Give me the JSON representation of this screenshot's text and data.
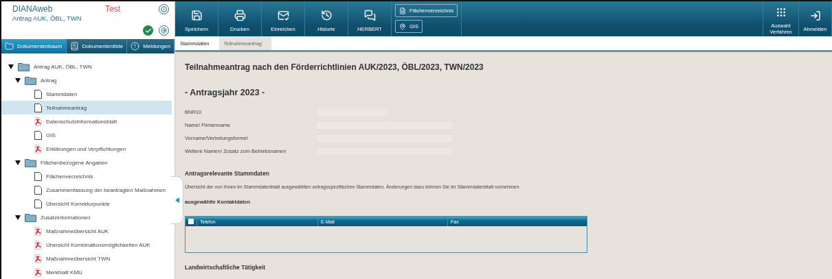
{
  "app": {
    "name": "DIANAweb",
    "environment": "Test",
    "subtitle": "Antrag AUK, ÖBL, TWN"
  },
  "side_tabs": [
    {
      "label": "Dokumentenbaum",
      "selected": true
    },
    {
      "label": "Dokumentenliste",
      "selected": false
    },
    {
      "label": "Meldungen",
      "selected": false
    }
  ],
  "tree": [
    {
      "label": "Antrag AUK, ÖBL, TWN",
      "kind": "folder",
      "expanded": true,
      "selected": false,
      "children": [
        {
          "label": "Antrag",
          "kind": "folder",
          "expanded": true,
          "selected": false,
          "children": [
            {
              "label": "Stammdaten",
              "kind": "doc",
              "selected": false
            },
            {
              "label": "Teilnahmeantrag",
              "kind": "doc",
              "selected": true
            },
            {
              "label": "Datenschutzinformationsblatt",
              "kind": "pdf",
              "selected": false
            },
            {
              "label": "GIS",
              "kind": "doc",
              "selected": false
            },
            {
              "label": "Erklärungen und Verpflichtungen",
              "kind": "pdf",
              "selected": false
            }
          ]
        },
        {
          "label": "Flächenbezogene Angaben",
          "kind": "folder",
          "expanded": true,
          "selected": false,
          "children": [
            {
              "label": "Flächenverzeichnis",
              "kind": "doc",
              "selected": false
            },
            {
              "label": "Zusammenfassung der beantragten Maßnahmen",
              "kind": "doc",
              "selected": false
            },
            {
              "label": "Übersicht Korrekturpunkte",
              "kind": "doc",
              "selected": false
            }
          ]
        },
        {
          "label": "Zusatzinformationen",
          "kind": "folder",
          "expanded": true,
          "selected": false,
          "children": [
            {
              "label": "Maßnahmeübersicht AUK",
              "kind": "pdf",
              "selected": false
            },
            {
              "label": "Übersicht Kombinationsmöglichkeiten AUK",
              "kind": "pdf",
              "selected": false
            },
            {
              "label": "Maßnahmeübersicht TWN",
              "kind": "pdf",
              "selected": false
            },
            {
              "label": "Merkblatt KMU",
              "kind": "pdf",
              "selected": false
            }
          ]
        }
      ]
    }
  ],
  "toolbar": [
    "Speichern",
    "Drucken",
    "Einreichen",
    "Historie",
    "HERBERT"
  ],
  "toolbar_links": [
    "Flächenverzeichnis",
    "GIS"
  ],
  "toolbar_right": [
    "Auswahl Verfahren",
    "Abmelden"
  ],
  "tabs": [
    {
      "label": "Stammdaten",
      "selected": true
    },
    {
      "label": "Teilnahmeantrag",
      "selected": false
    }
  ],
  "form": {
    "title": "Teilnahmeantrag nach den Förderrichtlinien AUK/2023, ÖBL/2023, TWN/2023",
    "year_heading": "- Antragsjahr 2023 -",
    "fields": [
      "BNR10",
      "Name/ Firmenname",
      "Vorname/Vertretungsformel",
      "Weitere Namen/ Zusatz zum Betriebsnamen"
    ],
    "section": "Antragsrelevante Stammdaten",
    "description": "Übersicht der von Ihnen im Stammdatenblatt ausgewählten antragsspezifischen Stammdaten. Änderungen dazu können Sie im Stammdatenblatt vornehmen.",
    "contacts_heading": "ausgewählte Kontaktdaten",
    "contacts_table": {
      "select_all_checked": false,
      "columns": [
        "Telefon",
        "E-Mail",
        "Fax"
      ]
    },
    "next_section": "Landwirtschaftliche Tätigkeit"
  }
}
